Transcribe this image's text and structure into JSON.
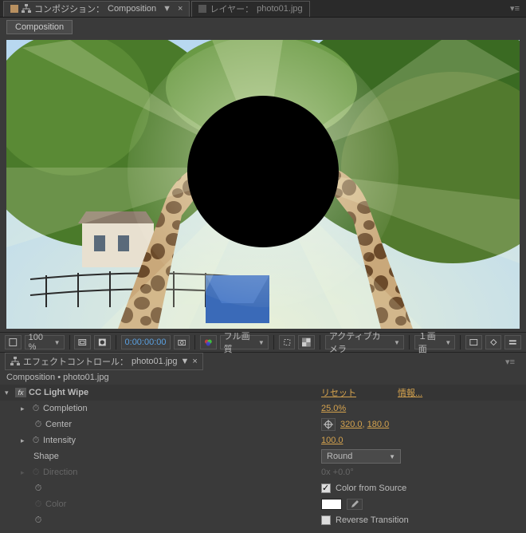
{
  "top_tabs": {
    "comp_tab_prefix": "コンポジション：",
    "comp_tab_name": "Composition",
    "layer_tab_prefix": "レイヤー：",
    "layer_tab_name": "photo01.jpg"
  },
  "breadcrumb_chip": "Composition",
  "viewer_toolbar": {
    "zoom": "100 %",
    "timecode": "0:00:00:00",
    "quality": "フル画質",
    "camera": "アクティブカメラ",
    "views": "１画面"
  },
  "effects_panel": {
    "tab_prefix": "エフェクトコントロール：",
    "tab_name": "photo01.jpg",
    "breadcrumb": "Composition • photo01.jpg",
    "effect_name": "CC Light Wipe",
    "reset": "リセット",
    "info": "情報...",
    "props": {
      "completion": {
        "label": "Completion",
        "value": "25.0%"
      },
      "center": {
        "label": "Center",
        "value_x": "320.0",
        "value_y": "180.0"
      },
      "intensity": {
        "label": "Intensity",
        "value": "100.0"
      },
      "shape": {
        "label": "Shape",
        "value": "Round"
      },
      "direction": {
        "label": "Direction",
        "value": "0x +0.0°"
      },
      "color_from_source": {
        "label": "Color from Source",
        "checked": true
      },
      "color": {
        "label": "Color",
        "value": "#ffffff"
      },
      "reverse": {
        "label": "Reverse Transition",
        "checked": false
      }
    }
  }
}
